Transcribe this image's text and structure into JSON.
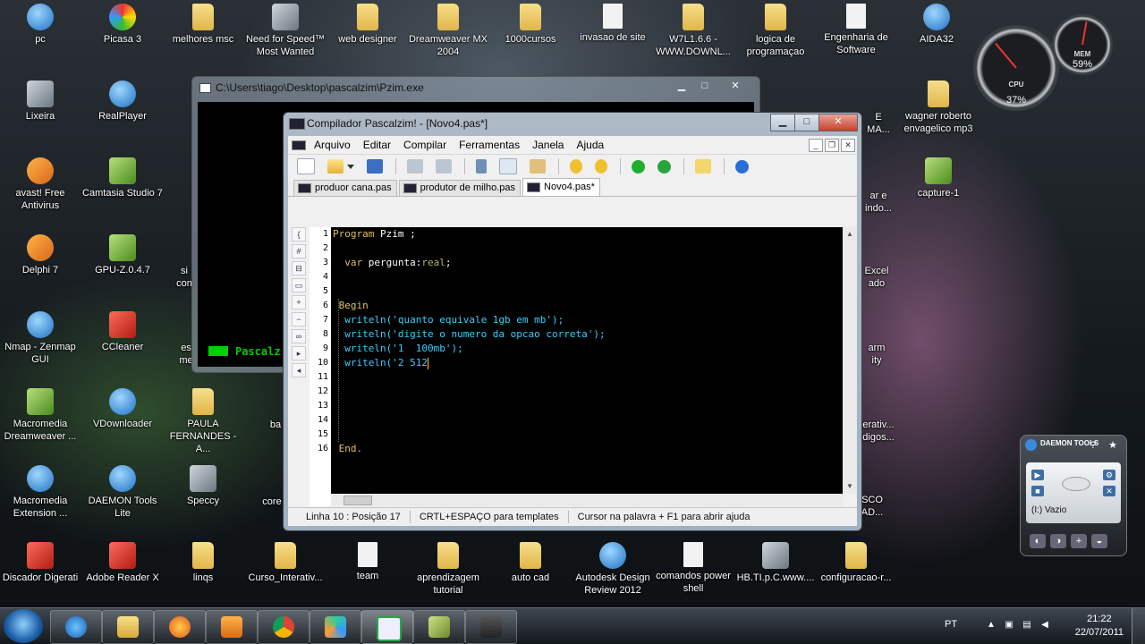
{
  "desktop_icons": [
    {
      "label": "pc",
      "type": "app-blue"
    },
    {
      "label": "Picasa 3",
      "type": "app-multi"
    },
    {
      "label": "melhores msc",
      "type": "folder"
    },
    {
      "label": "Need for Speed™ Most Wanted",
      "type": "app-gray"
    },
    {
      "label": "web designer",
      "type": "folder"
    },
    {
      "label": "Dreamweaver MX 2004",
      "type": "folder"
    },
    {
      "label": "1000cursos",
      "type": "folder"
    },
    {
      "label": "invasao de site",
      "type": "doc"
    },
    {
      "label": "W7L1.6.6 - WWW.DOWNL...",
      "type": "folder"
    },
    {
      "label": "logica de programaçao",
      "type": "folder"
    },
    {
      "label": "Engenharia de Software",
      "type": "doc"
    },
    {
      "label": "AIDA32",
      "type": "app-blue"
    },
    {
      "label": "Lixeira",
      "type": "app-gray"
    },
    {
      "label": "RealPlayer",
      "type": "app-blue"
    },
    {
      "label": "avast! Free Antivirus",
      "type": "app-orange"
    },
    {
      "label": "Camtasia Studio 7",
      "type": "app-green"
    },
    {
      "label": "Delphi 7",
      "type": "app-orange"
    },
    {
      "label": "GPU-Z.0.4.7",
      "type": "app-green"
    },
    {
      "label": "Nmap - Zenmap GUI",
      "type": "app-blue"
    },
    {
      "label": "CCleaner",
      "type": "app-red"
    },
    {
      "label": "Macromedia Dreamweaver ...",
      "type": "app-green"
    },
    {
      "label": "VDownloader",
      "type": "app-blue"
    },
    {
      "label": "PAULA FERNANDES - A...",
      "type": "folder"
    },
    {
      "label": "Macromedia Extension ...",
      "type": "app-blue"
    },
    {
      "label": "DAEMON Tools Lite",
      "type": "app-blue"
    },
    {
      "label": "Speccy",
      "type": "app-gray"
    },
    {
      "label": "Discador Digerati",
      "type": "app-red"
    },
    {
      "label": "Adobe Reader X",
      "type": "app-red"
    },
    {
      "label": "linqs",
      "type": "folder"
    },
    {
      "label": "Curso_Interativ...",
      "type": "folder"
    },
    {
      "label": "team",
      "type": "doc"
    },
    {
      "label": "aprendizagem tutorial",
      "type": "folder"
    },
    {
      "label": "auto cad",
      "type": "folder"
    },
    {
      "label": "Autodesk Design Review 2012",
      "type": "app-blue"
    },
    {
      "label": "comandos power shell",
      "type": "doc"
    },
    {
      "label": "HB.TI.p.C.www....",
      "type": "app-gray"
    },
    {
      "label": "configuracao-r...",
      "type": "folder"
    },
    {
      "label": "wagner roberto envagelico mp3",
      "type": "folder"
    },
    {
      "label": "capture-1",
      "type": "app-green"
    }
  ],
  "partial_labels": {
    "si_co": "si\ncon",
    "es_me": "es\nme",
    "ba": "ba",
    "core": "core",
    "ar_indo": "ar e\nindo...",
    "excel": "Excel\nado",
    "arm_ity": "arm\nity",
    "erativ": "erativ...\ndigos...",
    "sco_ad": "SCO\nAD...",
    "e_ma": "E\nMA..."
  },
  "console_window": {
    "title": "C:\\Users\\tiago\\Desktop\\pascalzim\\Pzim.exe",
    "output_text": "Pascalz"
  },
  "pascal_window": {
    "title": "Compilador Pascalzim! - [Novo4.pas*]",
    "menu": [
      "Arquivo",
      "Editar",
      "Compilar",
      "Ferramentas",
      "Janela",
      "Ajuda"
    ],
    "tabs": [
      "produor cana.pas",
      "produtor de milho.pas",
      "Novo4.pas*"
    ],
    "active_tab": 2,
    "line_numbers": [
      "1",
      "2",
      "3",
      "4",
      "5",
      "6",
      "7",
      "8",
      "9",
      "10",
      "11",
      "12",
      "13",
      "14",
      "15",
      "16"
    ],
    "code": {
      "l1_kw": "Program",
      "l1_id": " Pzim ;",
      "l3_kw": "  var",
      "l3_id": " pergunta",
      "l3_colon": ":",
      "l3_ty": "real",
      "l3_end": ";",
      "l6_kw": " Begin",
      "l7": "  writeln('quanto equivale 1gb em mb');",
      "l8": "  writeln('digite o numero da opcao correta');",
      "l9": "  writeln('1  100mb');",
      "l10": "  writeln('2 512",
      "l16_kw": " End."
    },
    "status": {
      "position": "Linha 10 : Posição 17",
      "hint1": "CRTL+ESPAÇO para templates",
      "hint2": "Cursor na palavra + F1 para abrir ajuda"
    }
  },
  "gauges": {
    "cpu_label": "CPU",
    "cpu_value": "37%",
    "mem_label": "MEM",
    "mem_value": "59%"
  },
  "daemon_tools": {
    "title": "DAEMON TOOLS",
    "drive_label": "(I:) Vazio"
  },
  "taskbar": {
    "language": "PT",
    "time": "21:22",
    "date": "22/07/2011"
  },
  "colors": {
    "code_background": "#000000",
    "keyword": "#e0c060",
    "string": "#36d0ff"
  }
}
